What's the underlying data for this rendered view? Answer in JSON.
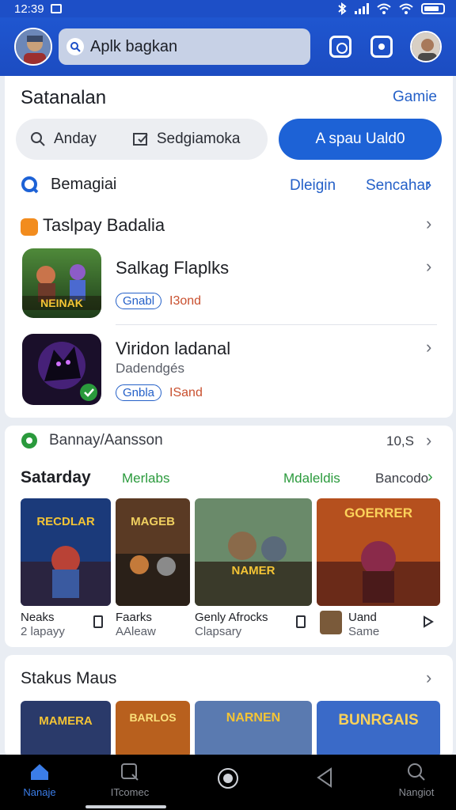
{
  "status_bar": {
    "time": "12:39"
  },
  "header": {
    "search_text": "Aplk bagkan"
  },
  "section_top": {
    "title": "Satanalan",
    "right_link": "Gamie",
    "filter_left_1": "Anday",
    "filter_left_2": "Sedgiamoka",
    "action_button": "A spau Uald0"
  },
  "row_bemagiai": {
    "label": "Bemagiai",
    "link1": "Dleigin",
    "link2": "Sencahar"
  },
  "list_section": {
    "title": "Taslpay Badalia",
    "items": [
      {
        "title": "Salkag Flaplks",
        "subtitle": "",
        "tag": "Gnabl",
        "extra": "I3ond",
        "thumb_text": "NEINAK"
      },
      {
        "title": "Viridon ladanal",
        "subtitle": "Dadendgés",
        "tag": "Gnbla",
        "extra": "ISand",
        "thumb_text": ""
      }
    ]
  },
  "section_mid": {
    "header": "Bannay/Aansson",
    "header_value": "10,S",
    "title": "Satarday",
    "tab1": "Merlabs",
    "tab2": "Mdaleldis",
    "tab3": "Bancodo",
    "games": [
      {
        "art": "RECDLAR",
        "title": "Neaks",
        "sub": "2 lapayy"
      },
      {
        "art": "MAGEB",
        "title": "Faarks",
        "sub": "AAleaw"
      },
      {
        "art": "NAMER",
        "title": "Genly Afrocks",
        "sub": "Clapsary"
      },
      {
        "art": "GOERRER",
        "title": "Uand",
        "sub": "Same"
      }
    ]
  },
  "section_bottom": {
    "title": "Stakus Maus",
    "games": [
      {
        "art": "MAMERA"
      },
      {
        "art": "BARLOS"
      },
      {
        "art": "NARNEN"
      },
      {
        "art": "BUNRGAIS"
      }
    ]
  },
  "bottom_nav": {
    "items": [
      {
        "label": "Nanaje",
        "icon": "home-icon",
        "active": true
      },
      {
        "label": "ITcomec",
        "icon": "search-square-icon",
        "active": false
      },
      {
        "label": "",
        "icon": "record-icon",
        "active": false
      },
      {
        "label": "",
        "icon": "back-triangle-icon",
        "active": false
      },
      {
        "label": "Nangiot",
        "icon": "search-icon",
        "active": false
      }
    ]
  },
  "colors": {
    "primary": "#1d62d6",
    "header": "#1f56d0",
    "green": "#2a9a3c",
    "orange": "#f28c1e"
  }
}
